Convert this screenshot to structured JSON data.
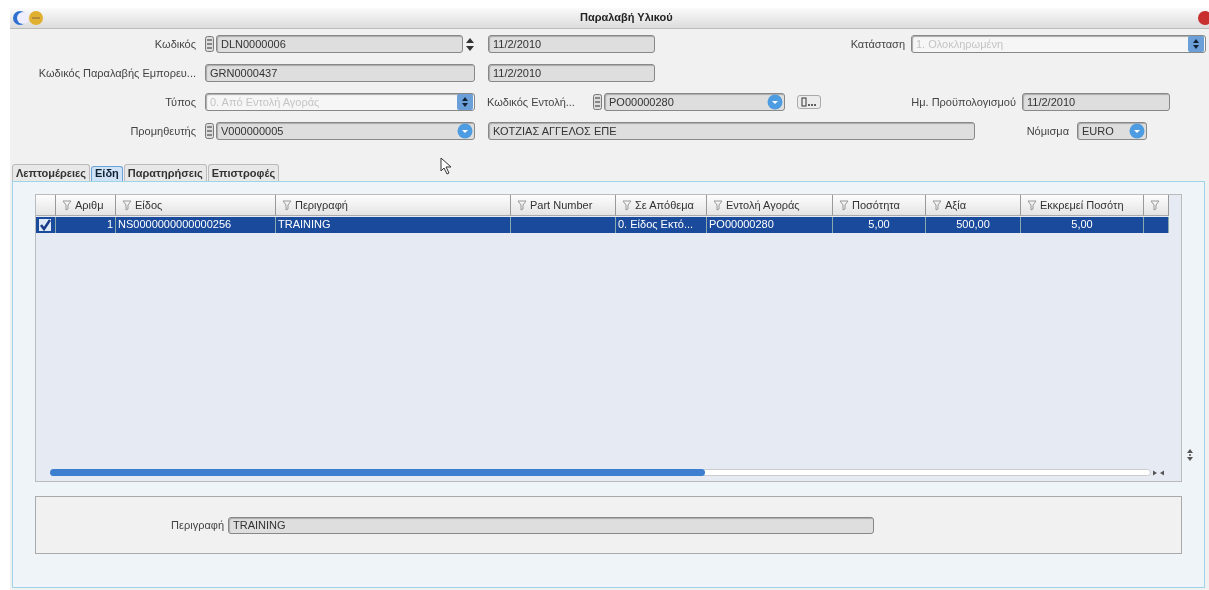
{
  "window": {
    "title": "Παραλαβή Υλικού"
  },
  "header": {
    "code": {
      "label": "Κωδικός",
      "value": "DLN0000006"
    },
    "code_date": {
      "value": "11/2/2010"
    },
    "status": {
      "label": "Κατάσταση",
      "value": "1. Ολοκληρωμένη",
      "disabled": true
    },
    "receipt_code": {
      "label": "Κωδικός Παραλαβής Εμπορευ...",
      "value": "GRN0000437"
    },
    "receipt_date": {
      "value": "11/2/2010"
    },
    "type": {
      "label": "Τύπος",
      "value": "0. Από Εντολή Αγοράς",
      "disabled": true
    },
    "order_code": {
      "label": "Κωδικός Εντολή...",
      "value": "PO00000280"
    },
    "budget_date": {
      "label": "Ημ. Προϋπολογισμού",
      "value": "11/2/2010"
    },
    "supplier": {
      "label": "Προμηθευτής",
      "value": "V000000005"
    },
    "supplier_name": {
      "value": "ΚΟΤΖΙΑΣ ΑΓΓΕΛΟΣ ΕΠΕ"
    },
    "currency": {
      "label": "Νόμισμα",
      "value": "EURO"
    }
  },
  "tabs": [
    {
      "label": "Λεπτομέρειες",
      "selected": false
    },
    {
      "label": "Είδη",
      "selected": true
    },
    {
      "label": "Παρατηρήσεις",
      "selected": false
    },
    {
      "label": "Επιστροφές",
      "selected": false
    }
  ],
  "table": {
    "columns": [
      "Αριθμ",
      "Είδος",
      "Περιγραφή",
      "Part Number",
      "Σε Απόθεμα",
      "Εντολή Αγοράς",
      "Ποσότητα",
      "Αξία",
      "Εκκρεμεί Ποσότη",
      ""
    ],
    "rows": [
      {
        "checked": true,
        "selected": true,
        "cells": [
          "1",
          "NS0000000000000256",
          "TRAINING",
          "",
          "0. Είδος Εκτό...",
          "PO00000280",
          "5,00",
          "500,00",
          "5,00",
          ""
        ]
      }
    ]
  },
  "detail": {
    "label": "Περιγραφή",
    "value": "TRAINING"
  }
}
